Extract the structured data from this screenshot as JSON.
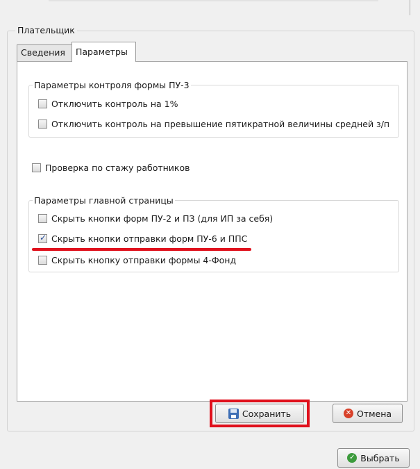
{
  "groupbox": {
    "title": "Плательщик"
  },
  "tabs": [
    {
      "label": "Сведения",
      "active": false
    },
    {
      "label": "Параметры",
      "active": true
    }
  ],
  "pu3_section": {
    "title": "Параметры контроля формы ПУ-3",
    "options": [
      {
        "label": "Отключить контроль на 1%",
        "checked": false
      },
      {
        "label": "Отключить контроль на превышение пятикратной величины средней з/п",
        "checked": false
      }
    ]
  },
  "staj_option": {
    "label": "Проверка по стажу работников",
    "checked": false
  },
  "main_page_section": {
    "title": "Параметры главной страницы",
    "options": [
      {
        "label": "Скрыть кнопки форм ПУ-2 и ПЗ (для ИП за себя)",
        "checked": false
      },
      {
        "label": "Скрыть кнопки отправки форм ПУ-6 и ППС",
        "checked": true
      },
      {
        "label": "Скрыть кнопку отправки формы 4-Фонд",
        "checked": false
      }
    ]
  },
  "buttons": {
    "save": {
      "label": "Сохранить",
      "icon": "floppy-disk-icon"
    },
    "cancel": {
      "label": "Отмена",
      "icon": "cancel-icon"
    },
    "select": {
      "label": "Выбрать",
      "icon": "check-icon"
    }
  },
  "colors": {
    "highlight": "#e0101c",
    "panel_bg": "#ffffff",
    "window_bg": "#f0f0f0"
  }
}
